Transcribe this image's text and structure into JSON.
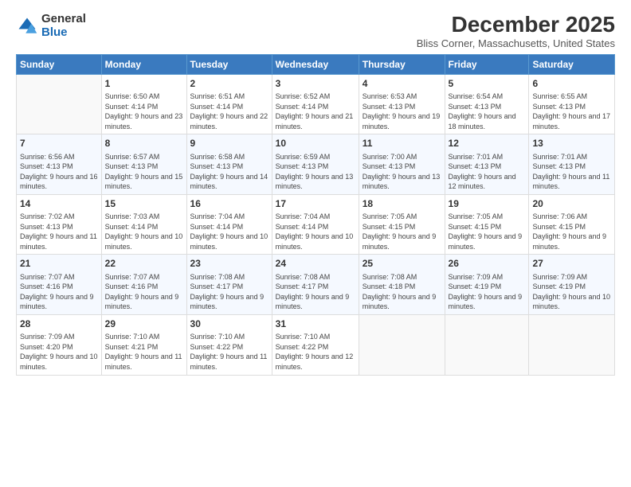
{
  "logo": {
    "general": "General",
    "blue": "Blue"
  },
  "header": {
    "month": "December 2025",
    "location": "Bliss Corner, Massachusetts, United States"
  },
  "weekdays": [
    "Sunday",
    "Monday",
    "Tuesday",
    "Wednesday",
    "Thursday",
    "Friday",
    "Saturday"
  ],
  "weeks": [
    [
      {
        "day": "",
        "sunrise": "",
        "sunset": "",
        "daylight": ""
      },
      {
        "day": "1",
        "sunrise": "Sunrise: 6:50 AM",
        "sunset": "Sunset: 4:14 PM",
        "daylight": "Daylight: 9 hours and 23 minutes."
      },
      {
        "day": "2",
        "sunrise": "Sunrise: 6:51 AM",
        "sunset": "Sunset: 4:14 PM",
        "daylight": "Daylight: 9 hours and 22 minutes."
      },
      {
        "day": "3",
        "sunrise": "Sunrise: 6:52 AM",
        "sunset": "Sunset: 4:14 PM",
        "daylight": "Daylight: 9 hours and 21 minutes."
      },
      {
        "day": "4",
        "sunrise": "Sunrise: 6:53 AM",
        "sunset": "Sunset: 4:13 PM",
        "daylight": "Daylight: 9 hours and 19 minutes."
      },
      {
        "day": "5",
        "sunrise": "Sunrise: 6:54 AM",
        "sunset": "Sunset: 4:13 PM",
        "daylight": "Daylight: 9 hours and 18 minutes."
      },
      {
        "day": "6",
        "sunrise": "Sunrise: 6:55 AM",
        "sunset": "Sunset: 4:13 PM",
        "daylight": "Daylight: 9 hours and 17 minutes."
      }
    ],
    [
      {
        "day": "7",
        "sunrise": "Sunrise: 6:56 AM",
        "sunset": "Sunset: 4:13 PM",
        "daylight": "Daylight: 9 hours and 16 minutes."
      },
      {
        "day": "8",
        "sunrise": "Sunrise: 6:57 AM",
        "sunset": "Sunset: 4:13 PM",
        "daylight": "Daylight: 9 hours and 15 minutes."
      },
      {
        "day": "9",
        "sunrise": "Sunrise: 6:58 AM",
        "sunset": "Sunset: 4:13 PM",
        "daylight": "Daylight: 9 hours and 14 minutes."
      },
      {
        "day": "10",
        "sunrise": "Sunrise: 6:59 AM",
        "sunset": "Sunset: 4:13 PM",
        "daylight": "Daylight: 9 hours and 13 minutes."
      },
      {
        "day": "11",
        "sunrise": "Sunrise: 7:00 AM",
        "sunset": "Sunset: 4:13 PM",
        "daylight": "Daylight: 9 hours and 13 minutes."
      },
      {
        "day": "12",
        "sunrise": "Sunrise: 7:01 AM",
        "sunset": "Sunset: 4:13 PM",
        "daylight": "Daylight: 9 hours and 12 minutes."
      },
      {
        "day": "13",
        "sunrise": "Sunrise: 7:01 AM",
        "sunset": "Sunset: 4:13 PM",
        "daylight": "Daylight: 9 hours and 11 minutes."
      }
    ],
    [
      {
        "day": "14",
        "sunrise": "Sunrise: 7:02 AM",
        "sunset": "Sunset: 4:13 PM",
        "daylight": "Daylight: 9 hours and 11 minutes."
      },
      {
        "day": "15",
        "sunrise": "Sunrise: 7:03 AM",
        "sunset": "Sunset: 4:14 PM",
        "daylight": "Daylight: 9 hours and 10 minutes."
      },
      {
        "day": "16",
        "sunrise": "Sunrise: 7:04 AM",
        "sunset": "Sunset: 4:14 PM",
        "daylight": "Daylight: 9 hours and 10 minutes."
      },
      {
        "day": "17",
        "sunrise": "Sunrise: 7:04 AM",
        "sunset": "Sunset: 4:14 PM",
        "daylight": "Daylight: 9 hours and 10 minutes."
      },
      {
        "day": "18",
        "sunrise": "Sunrise: 7:05 AM",
        "sunset": "Sunset: 4:15 PM",
        "daylight": "Daylight: 9 hours and 9 minutes."
      },
      {
        "day": "19",
        "sunrise": "Sunrise: 7:05 AM",
        "sunset": "Sunset: 4:15 PM",
        "daylight": "Daylight: 9 hours and 9 minutes."
      },
      {
        "day": "20",
        "sunrise": "Sunrise: 7:06 AM",
        "sunset": "Sunset: 4:15 PM",
        "daylight": "Daylight: 9 hours and 9 minutes."
      }
    ],
    [
      {
        "day": "21",
        "sunrise": "Sunrise: 7:07 AM",
        "sunset": "Sunset: 4:16 PM",
        "daylight": "Daylight: 9 hours and 9 minutes."
      },
      {
        "day": "22",
        "sunrise": "Sunrise: 7:07 AM",
        "sunset": "Sunset: 4:16 PM",
        "daylight": "Daylight: 9 hours and 9 minutes."
      },
      {
        "day": "23",
        "sunrise": "Sunrise: 7:08 AM",
        "sunset": "Sunset: 4:17 PM",
        "daylight": "Daylight: 9 hours and 9 minutes."
      },
      {
        "day": "24",
        "sunrise": "Sunrise: 7:08 AM",
        "sunset": "Sunset: 4:17 PM",
        "daylight": "Daylight: 9 hours and 9 minutes."
      },
      {
        "day": "25",
        "sunrise": "Sunrise: 7:08 AM",
        "sunset": "Sunset: 4:18 PM",
        "daylight": "Daylight: 9 hours and 9 minutes."
      },
      {
        "day": "26",
        "sunrise": "Sunrise: 7:09 AM",
        "sunset": "Sunset: 4:19 PM",
        "daylight": "Daylight: 9 hours and 9 minutes."
      },
      {
        "day": "27",
        "sunrise": "Sunrise: 7:09 AM",
        "sunset": "Sunset: 4:19 PM",
        "daylight": "Daylight: 9 hours and 10 minutes."
      }
    ],
    [
      {
        "day": "28",
        "sunrise": "Sunrise: 7:09 AM",
        "sunset": "Sunset: 4:20 PM",
        "daylight": "Daylight: 9 hours and 10 minutes."
      },
      {
        "day": "29",
        "sunrise": "Sunrise: 7:10 AM",
        "sunset": "Sunset: 4:21 PM",
        "daylight": "Daylight: 9 hours and 11 minutes."
      },
      {
        "day": "30",
        "sunrise": "Sunrise: 7:10 AM",
        "sunset": "Sunset: 4:22 PM",
        "daylight": "Daylight: 9 hours and 11 minutes."
      },
      {
        "day": "31",
        "sunrise": "Sunrise: 7:10 AM",
        "sunset": "Sunset: 4:22 PM",
        "daylight": "Daylight: 9 hours and 12 minutes."
      },
      {
        "day": "",
        "sunrise": "",
        "sunset": "",
        "daylight": ""
      },
      {
        "day": "",
        "sunrise": "",
        "sunset": "",
        "daylight": ""
      },
      {
        "day": "",
        "sunrise": "",
        "sunset": "",
        "daylight": ""
      }
    ]
  ]
}
